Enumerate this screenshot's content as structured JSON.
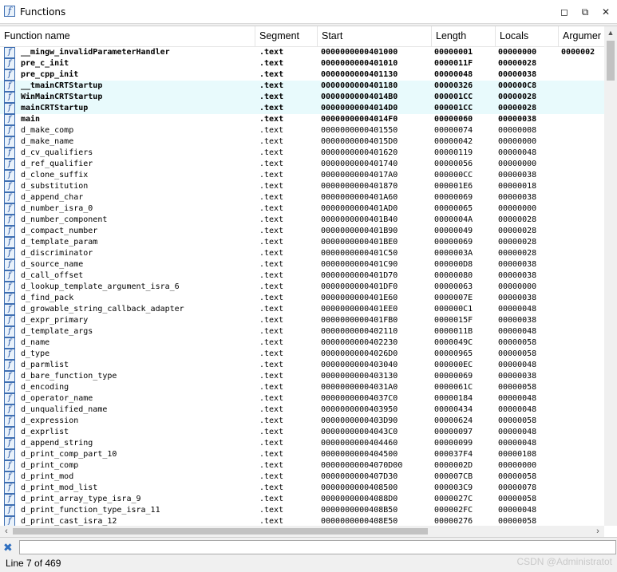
{
  "window": {
    "title": "Functions",
    "buttons": [
      "maximize",
      "restore",
      "close"
    ]
  },
  "table": {
    "columns": [
      "Function name",
      "Segment",
      "Start",
      "Length",
      "Locals",
      "Argumer"
    ],
    "rows": [
      {
        "name": "__mingw_invalidParameterHandler",
        "segment": ".text",
        "start": "0000000000401000",
        "length": "00000001",
        "locals": "00000000",
        "args": "0000002",
        "bold": true,
        "highlight": false
      },
      {
        "name": "pre_c_init",
        "segment": ".text",
        "start": "0000000000401010",
        "length": "0000011F",
        "locals": "00000028",
        "args": "",
        "bold": true,
        "highlight": false
      },
      {
        "name": "pre_cpp_init",
        "segment": ".text",
        "start": "0000000000401130",
        "length": "00000048",
        "locals": "00000038",
        "args": "",
        "bold": true,
        "highlight": false
      },
      {
        "name": "__tmainCRTStartup",
        "segment": ".text",
        "start": "0000000000401180",
        "length": "00000326",
        "locals": "000000C8",
        "args": "",
        "bold": true,
        "highlight": true
      },
      {
        "name": "WinMainCRTStartup",
        "segment": ".text",
        "start": "00000000004014B0",
        "length": "000001CC",
        "locals": "00000028",
        "args": "",
        "bold": true,
        "highlight": true
      },
      {
        "name": "mainCRTStartup",
        "segment": ".text",
        "start": "00000000004014D0",
        "length": "000001CC",
        "locals": "00000028",
        "args": "",
        "bold": true,
        "highlight": true
      },
      {
        "name": "main",
        "segment": ".text",
        "start": "00000000004014F0",
        "length": "00000060",
        "locals": "00000038",
        "args": "",
        "bold": true,
        "highlight": false
      },
      {
        "name": "d_make_comp",
        "segment": ".text",
        "start": "0000000000401550",
        "length": "00000074",
        "locals": "00000008",
        "args": "",
        "bold": false,
        "highlight": false
      },
      {
        "name": "d_make_name",
        "segment": ".text",
        "start": "00000000004015D0",
        "length": "00000042",
        "locals": "00000000",
        "args": "",
        "bold": false,
        "highlight": false
      },
      {
        "name": "d_cv_qualifiers",
        "segment": ".text",
        "start": "0000000000401620",
        "length": "00000119",
        "locals": "00000048",
        "args": "",
        "bold": false,
        "highlight": false
      },
      {
        "name": "d_ref_qualifier",
        "segment": ".text",
        "start": "0000000000401740",
        "length": "00000056",
        "locals": "00000000",
        "args": "",
        "bold": false,
        "highlight": false
      },
      {
        "name": "d_clone_suffix",
        "segment": ".text",
        "start": "00000000004017A0",
        "length": "000000CC",
        "locals": "00000038",
        "args": "",
        "bold": false,
        "highlight": false
      },
      {
        "name": "d_substitution",
        "segment": ".text",
        "start": "0000000000401870",
        "length": "000001E6",
        "locals": "00000018",
        "args": "",
        "bold": false,
        "highlight": false
      },
      {
        "name": "d_append_char",
        "segment": ".text",
        "start": "0000000000401A60",
        "length": "00000069",
        "locals": "00000038",
        "args": "",
        "bold": false,
        "highlight": false
      },
      {
        "name": "d_number_isra_0",
        "segment": ".text",
        "start": "0000000000401AD0",
        "length": "00000065",
        "locals": "00000000",
        "args": "",
        "bold": false,
        "highlight": false
      },
      {
        "name": "d_number_component",
        "segment": ".text",
        "start": "0000000000401B40",
        "length": "0000004A",
        "locals": "00000028",
        "args": "",
        "bold": false,
        "highlight": false
      },
      {
        "name": "d_compact_number",
        "segment": ".text",
        "start": "0000000000401B90",
        "length": "00000049",
        "locals": "00000028",
        "args": "",
        "bold": false,
        "highlight": false
      },
      {
        "name": "d_template_param",
        "segment": ".text",
        "start": "0000000000401BE0",
        "length": "00000069",
        "locals": "00000028",
        "args": "",
        "bold": false,
        "highlight": false
      },
      {
        "name": "d_discriminator",
        "segment": ".text",
        "start": "0000000000401C50",
        "length": "0000003A",
        "locals": "00000028",
        "args": "",
        "bold": false,
        "highlight": false
      },
      {
        "name": "d_source_name",
        "segment": ".text",
        "start": "0000000000401C90",
        "length": "000000D8",
        "locals": "00000038",
        "args": "",
        "bold": false,
        "highlight": false
      },
      {
        "name": "d_call_offset",
        "segment": ".text",
        "start": "0000000000401D70",
        "length": "00000080",
        "locals": "00000038",
        "args": "",
        "bold": false,
        "highlight": false
      },
      {
        "name": "d_lookup_template_argument_isra_6",
        "segment": ".text",
        "start": "0000000000401DF0",
        "length": "00000063",
        "locals": "00000000",
        "args": "",
        "bold": false,
        "highlight": false
      },
      {
        "name": "d_find_pack",
        "segment": ".text",
        "start": "0000000000401E60",
        "length": "0000007E",
        "locals": "00000038",
        "args": "",
        "bold": false,
        "highlight": false
      },
      {
        "name": "d_growable_string_callback_adapter",
        "segment": ".text",
        "start": "0000000000401EE0",
        "length": "000000C1",
        "locals": "00000048",
        "args": "",
        "bold": false,
        "highlight": false
      },
      {
        "name": "d_expr_primary",
        "segment": ".text",
        "start": "0000000000401FB0",
        "length": "0000015F",
        "locals": "00000038",
        "args": "",
        "bold": false,
        "highlight": false
      },
      {
        "name": "d_template_args",
        "segment": ".text",
        "start": "0000000000402110",
        "length": "0000011B",
        "locals": "00000048",
        "args": "",
        "bold": false,
        "highlight": false
      },
      {
        "name": "d_name",
        "segment": ".text",
        "start": "0000000000402230",
        "length": "0000049C",
        "locals": "00000058",
        "args": "",
        "bold": false,
        "highlight": false
      },
      {
        "name": "d_type",
        "segment": ".text",
        "start": "00000000004026D0",
        "length": "00000965",
        "locals": "00000058",
        "args": "",
        "bold": false,
        "highlight": false
      },
      {
        "name": "d_parmlist",
        "segment": ".text",
        "start": "0000000000403040",
        "length": "000000EC",
        "locals": "00000048",
        "args": "",
        "bold": false,
        "highlight": false
      },
      {
        "name": "d_bare_function_type",
        "segment": ".text",
        "start": "0000000000403130",
        "length": "00000069",
        "locals": "00000038",
        "args": "",
        "bold": false,
        "highlight": false
      },
      {
        "name": "d_encoding",
        "segment": ".text",
        "start": "00000000004031A0",
        "length": "0000061C",
        "locals": "00000058",
        "args": "",
        "bold": false,
        "highlight": false
      },
      {
        "name": "d_operator_name",
        "segment": ".text",
        "start": "00000000004037C0",
        "length": "00000184",
        "locals": "00000048",
        "args": "",
        "bold": false,
        "highlight": false
      },
      {
        "name": "d_unqualified_name",
        "segment": ".text",
        "start": "0000000000403950",
        "length": "00000434",
        "locals": "00000048",
        "args": "",
        "bold": false,
        "highlight": false
      },
      {
        "name": "d_expression",
        "segment": ".text",
        "start": "0000000000403D90",
        "length": "00000624",
        "locals": "00000058",
        "args": "",
        "bold": false,
        "highlight": false
      },
      {
        "name": "d_exprlist",
        "segment": ".text",
        "start": "00000000004043C0",
        "length": "00000097",
        "locals": "00000048",
        "args": "",
        "bold": false,
        "highlight": false
      },
      {
        "name": "d_append_string",
        "segment": ".text",
        "start": "0000000000404460",
        "length": "00000099",
        "locals": "00000048",
        "args": "",
        "bold": false,
        "highlight": false
      },
      {
        "name": "d_print_comp_part_10",
        "segment": ".text",
        "start": "0000000000404500",
        "length": "000037F4",
        "locals": "00000108",
        "args": "",
        "bold": false,
        "highlight": false
      },
      {
        "name": "d_print_comp",
        "segment": ".text",
        "start": "00000000004070D00",
        "length": "0000002D",
        "locals": "00000000",
        "args": "",
        "bold": false,
        "highlight": false
      },
      {
        "name": "d_print_mod",
        "segment": ".text",
        "start": "0000000000407D30",
        "length": "000007CB",
        "locals": "00000058",
        "args": "",
        "bold": false,
        "highlight": false
      },
      {
        "name": "d_print_mod_list",
        "segment": ".text",
        "start": "0000000000408500",
        "length": "000003C9",
        "locals": "00000078",
        "args": "",
        "bold": false,
        "highlight": false
      },
      {
        "name": "d_print_array_type_isra_9",
        "segment": ".text",
        "start": "00000000004088D0",
        "length": "0000027C",
        "locals": "00000058",
        "args": "",
        "bold": false,
        "highlight": false
      },
      {
        "name": "d_print_function_type_isra_11",
        "segment": ".text",
        "start": "0000000000408B50",
        "length": "000002FC",
        "locals": "00000048",
        "args": "",
        "bold": false,
        "highlight": false
      },
      {
        "name": "d_print_cast_isra_12",
        "segment": ".text",
        "start": "0000000000408E50",
        "length": "00000276",
        "locals": "00000058",
        "args": "",
        "bold": false,
        "highlight": false
      }
    ]
  },
  "filter": {
    "value": ""
  },
  "status": {
    "text": "Line 7 of 469"
  },
  "watermark": {
    "text": "CSDN @Administratot"
  },
  "icons": {
    "function": "function-icon",
    "close_filter": "close-filter-icon"
  }
}
